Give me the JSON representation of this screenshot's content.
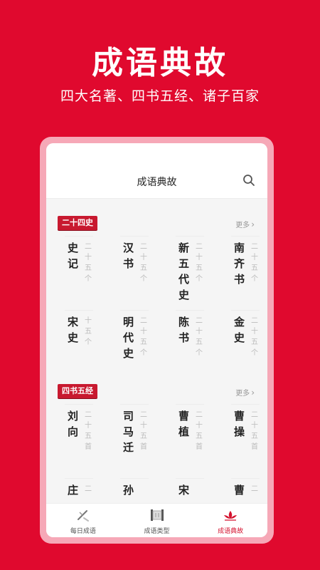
{
  "promo": {
    "title": "成语典故",
    "subtitle": "四大名著、四书五经、诸子百家"
  },
  "header": {
    "title": "成语典故",
    "search_icon": "search-icon"
  },
  "sections": [
    {
      "tag": "二十四史",
      "more": "更多",
      "books": [
        {
          "title": "史记",
          "count": "二十五个"
        },
        {
          "title": "汉书",
          "count": "二十五个"
        },
        {
          "title": "新五代史",
          "count": "二十五个"
        },
        {
          "title": "南齐书",
          "count": "二十五个"
        },
        {
          "title": "宋史",
          "count": "十五个"
        },
        {
          "title": "明代史",
          "count": "二十五个"
        },
        {
          "title": "陈书",
          "count": "二十五个"
        },
        {
          "title": "金史",
          "count": "二十五个"
        }
      ]
    },
    {
      "tag": "四书五经",
      "more": "更多",
      "books": [
        {
          "title": "刘向",
          "count": "二十五首"
        },
        {
          "title": "司马迁",
          "count": "二十五首"
        },
        {
          "title": "曹植",
          "count": "二十五首"
        },
        {
          "title": "曹操",
          "count": "二十五首"
        },
        {
          "title": "庄",
          "count": "二"
        },
        {
          "title": "孙",
          "count": ""
        },
        {
          "title": "宋",
          "count": ""
        },
        {
          "title": "曹",
          "count": "二"
        }
      ]
    }
  ],
  "tabs": [
    {
      "label": "每日成语",
      "icon": "brush-icon",
      "active": false
    },
    {
      "label": "成语类型",
      "icon": "scroll-icon",
      "active": false
    },
    {
      "label": "成语典故",
      "icon": "lotus-icon",
      "active": true
    }
  ],
  "colors": {
    "background": "#e0092e",
    "frame": "#f6a8b7",
    "tag": "#c8192f",
    "active_tab": "#d4122e"
  }
}
